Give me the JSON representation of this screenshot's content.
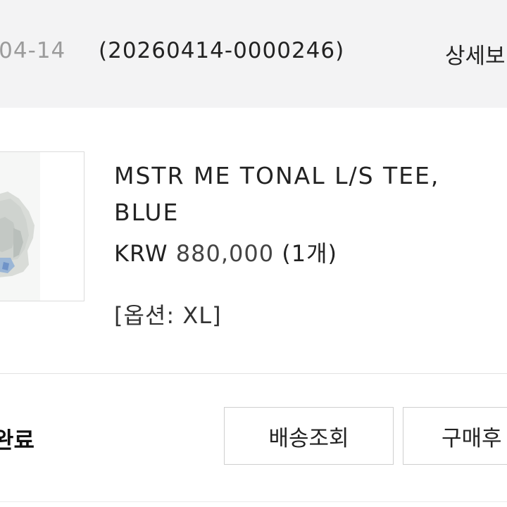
{
  "order": {
    "date": "-04-14",
    "number": "(20260414-0000246)",
    "detail_link": "상세보"
  },
  "product": {
    "name": "MSTR ME TONAL L/S TEE, BLUE",
    "price_currency": "KRW",
    "price_amount": "880,000",
    "quantity": "(1개)",
    "option": "[옵션: XL]"
  },
  "status": {
    "text": "완료"
  },
  "buttons": {
    "track": "배송조회",
    "confirm": "구매후"
  },
  "colors": {
    "header_bg": "#f3f3f4",
    "date_text": "#9b9b9b",
    "border": "#cfcfcf"
  }
}
